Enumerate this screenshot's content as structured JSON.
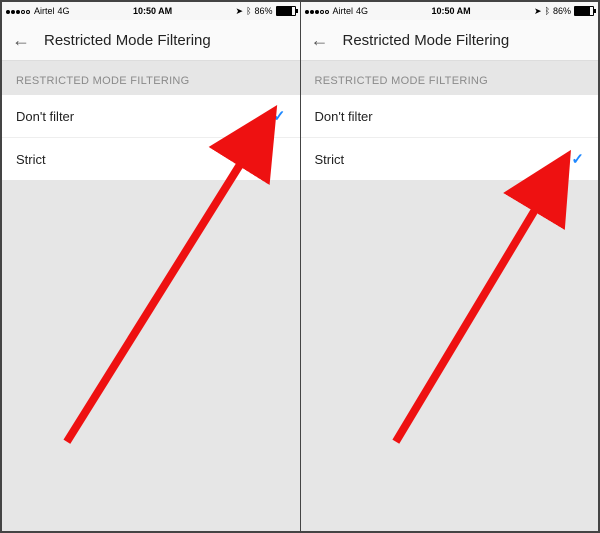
{
  "statusbar": {
    "carrier": "Airtel",
    "network": "4G",
    "time": "10:50 AM",
    "battery_pct": "86%"
  },
  "header": {
    "title": "Restricted Mode Filtering"
  },
  "section": {
    "title": "RESTRICTED MODE FILTERING"
  },
  "options": {
    "dont_filter": "Don't filter",
    "strict": "Strict"
  },
  "screens": {
    "left": {
      "selected": "dont_filter"
    },
    "right": {
      "selected": "strict"
    }
  }
}
